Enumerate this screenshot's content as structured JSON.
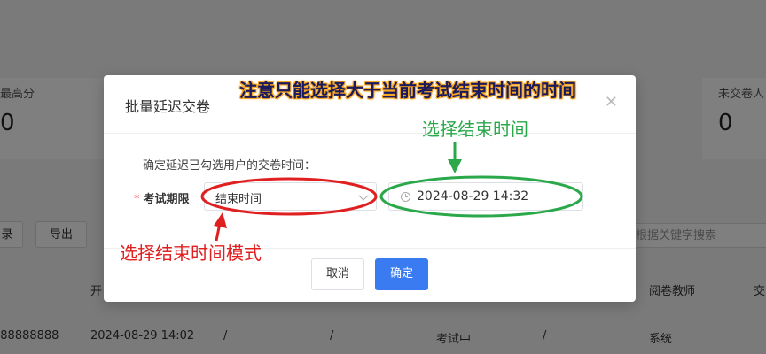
{
  "background": {
    "stats": [
      {
        "label": "最高分",
        "value": "0"
      },
      {
        "label": "未交卷人",
        "value": "0"
      }
    ],
    "buttons": [
      "录",
      "导出"
    ],
    "search_placeholder": "根据关键字搜索",
    "table_headers": [
      "开",
      "阅卷教师",
      "交"
    ],
    "row": {
      "phone": "888888888",
      "start_time": "2024-08-29 14:02",
      "col_a": "/",
      "col_b": "/",
      "status": "考试中",
      "col_c": "/",
      "teacher": "系统"
    }
  },
  "dialog": {
    "title": "批量延迟交卷",
    "close_icon": "close-icon",
    "description": "确定延迟已勾选用户的交卷时间：",
    "field_label": "考试期限",
    "required_mark": "*",
    "mode_select_value": "结束时间",
    "datetime_value": "2024-08-29 14:32",
    "cancel_label": "取消",
    "confirm_label": "确定"
  },
  "annotations": {
    "top_note": "注意只能选择大于当前考试结束时间的时间",
    "green_note": "选择结束时间",
    "red_note": "选择结束时间模式",
    "colors": {
      "green": "#2aa84a",
      "red": "#e02020",
      "title_outline": "#f5a623"
    }
  },
  "colors": {
    "primary": "#3a7bf2",
    "required": "#f56c6c"
  }
}
